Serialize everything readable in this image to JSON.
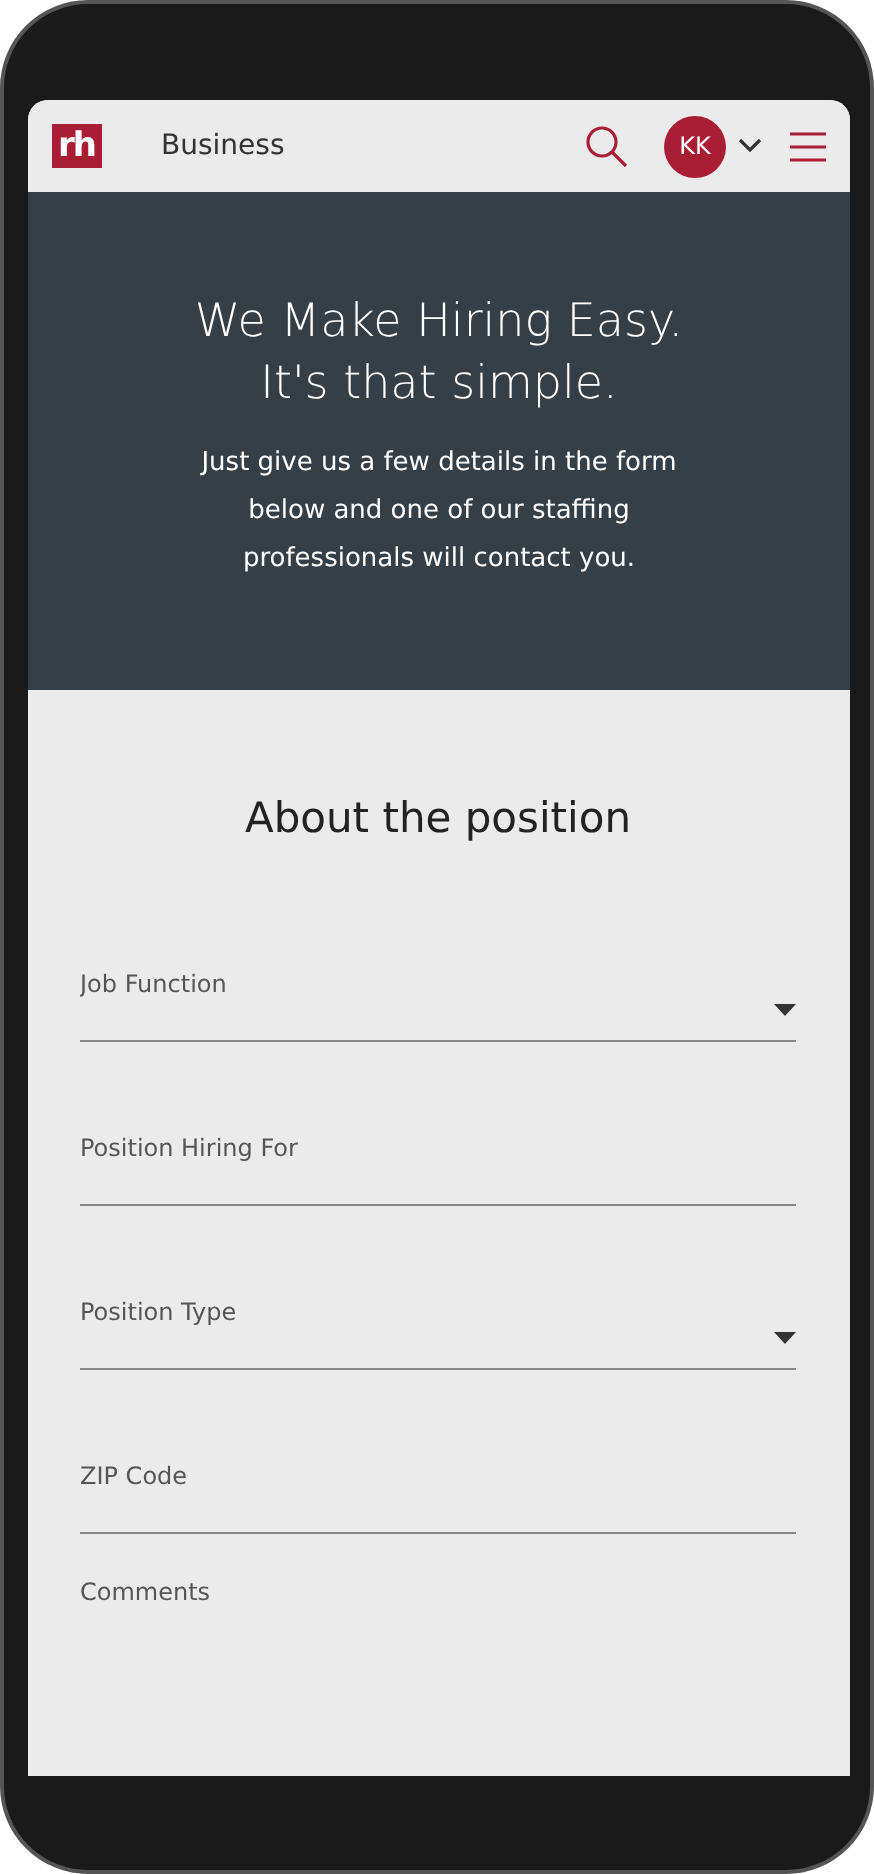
{
  "header": {
    "logo": "rh",
    "title": "Business",
    "avatar": "KK"
  },
  "hero": {
    "headline_lines": [
      "We Make Hiring Easy.",
      "It's that simple."
    ],
    "body": "Just give us a few details in the form below and one of our staffing professionals will contact you."
  },
  "form": {
    "title": "About the position",
    "fields": [
      {
        "kind": "select",
        "placeholder": "Job Function"
      },
      {
        "kind": "text",
        "placeholder": "Position Hiring For"
      },
      {
        "kind": "select",
        "placeholder": "Position Type"
      },
      {
        "kind": "text",
        "placeholder": "ZIP Code"
      },
      {
        "kind": "textarea",
        "placeholder": "Comments"
      }
    ]
  }
}
